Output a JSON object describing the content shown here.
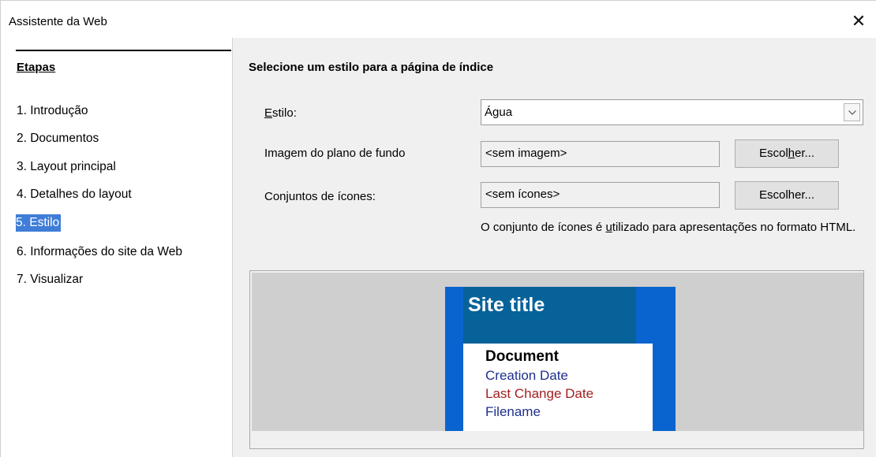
{
  "window": {
    "title": "Assistente da Web",
    "close_glyph": "✕"
  },
  "sidebar": {
    "heading": "Etapas",
    "steps": [
      {
        "label": "1. Introdução"
      },
      {
        "label": "2. Documentos"
      },
      {
        "label": "3. Layout principal"
      },
      {
        "label": "4. Detalhes do layout"
      },
      {
        "label": "5. Estilo",
        "active": true
      },
      {
        "label": "6. Informações do site da Web"
      },
      {
        "label": "7. Visualizar"
      }
    ]
  },
  "main": {
    "section_title": "Selecione um estilo para a página de índice",
    "style": {
      "label": "Estilo:",
      "value": "Água"
    },
    "background": {
      "label": "Imagem do plano de fundo",
      "value": "<sem imagem>",
      "button": "Escolher..."
    },
    "icons": {
      "label": "Conjuntos de ícones:",
      "value": "<sem ícones>",
      "button": "Escolher..."
    },
    "note": "O conjunto de ícones é utilizado para apresentações no formato HTML.",
    "preview": {
      "site_title": "Site title",
      "document": "Document",
      "creation_date": "Creation Date",
      "last_change_date": "Last Change Date",
      "filename": "Filename"
    }
  },
  "colors": {
    "selection": "#3f7dd8",
    "preview_frame": "#0a64d0",
    "preview_header": "#07629a",
    "link_blue": "#1f2f8f",
    "link_red": "#a11f1f"
  }
}
